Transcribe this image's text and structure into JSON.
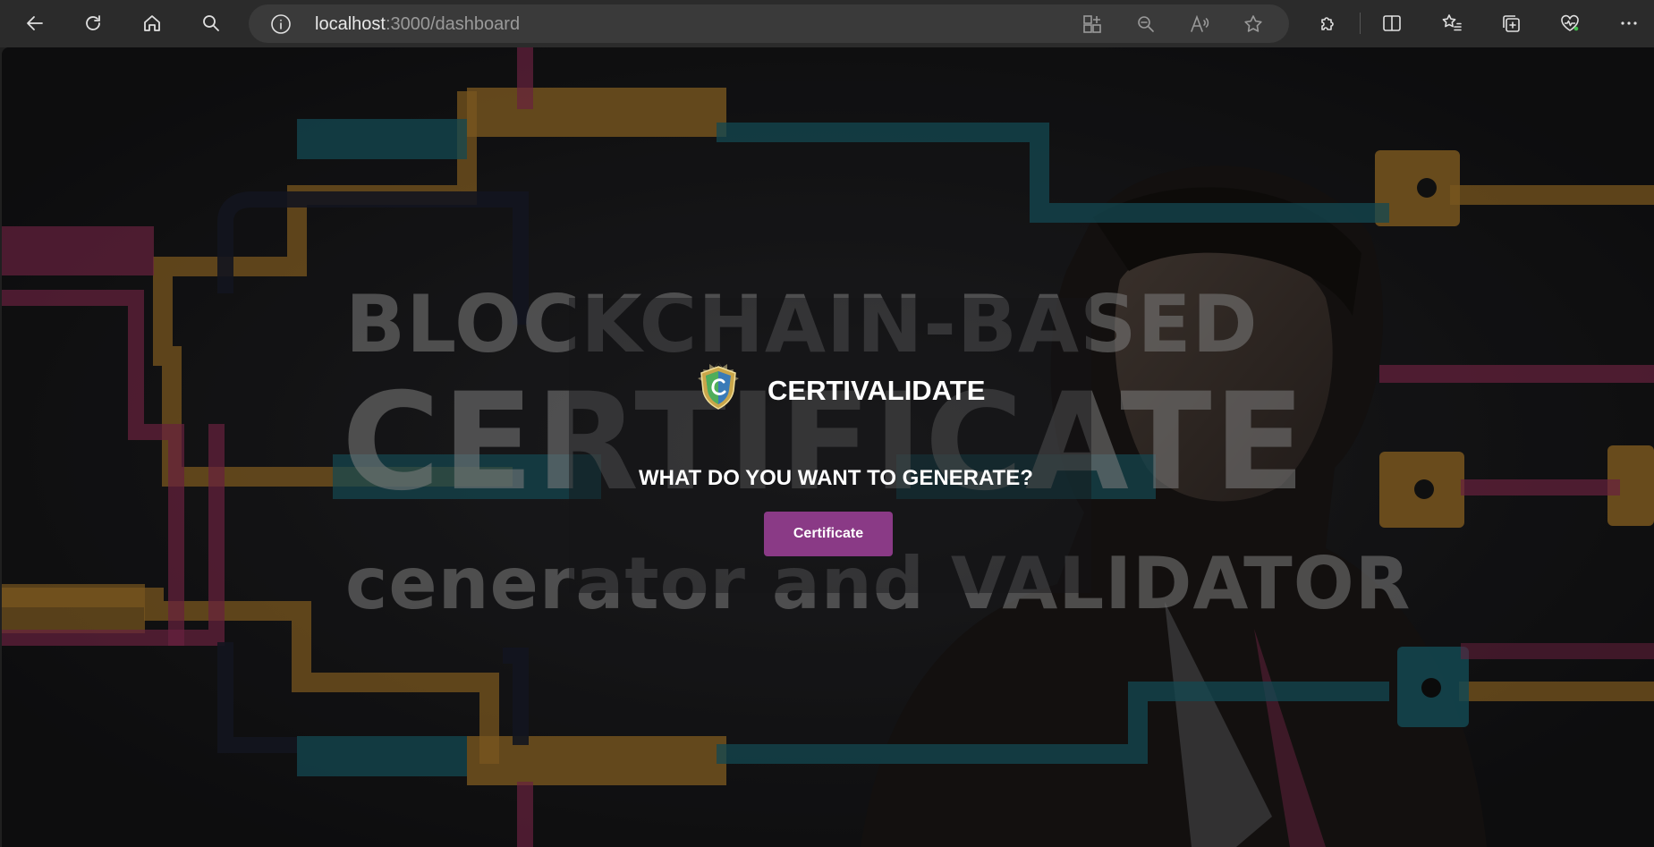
{
  "browser": {
    "url_host": "localhost",
    "url_path": ":3000/dashboard",
    "icons": {
      "back": "back-arrow-icon",
      "refresh": "refresh-icon",
      "home": "home-icon",
      "search": "search-icon",
      "site_info": "info-icon",
      "app_available": "app-grid-icon",
      "zoom": "zoom-out-icon",
      "read_aloud": "read-aloud-icon",
      "favorite": "star-icon",
      "extensions": "puzzle-icon",
      "split_screen": "split-screen-icon",
      "favorites": "favorites-list-icon",
      "collections": "collections-icon",
      "browser_essentials": "heart-pulse-icon",
      "more": "more-icon"
    }
  },
  "poster": {
    "line1": "BLOCKCHAIN-BASED",
    "line2": "CERTIFICATE",
    "line3": "cenerator and VALIDATOR"
  },
  "app": {
    "brand_name": "CERTIVALIDATE",
    "question": "WHAT DO YOU WANT TO GENERATE?",
    "certificate_button": "Certificate"
  },
  "colors": {
    "accent": "#8a3a86",
    "chrome_bg": "#2b2b2b",
    "address_bg": "#3a3a3a",
    "pipe_orange": "#b9842f",
    "pipe_teal": "#1f6f7d",
    "pipe_magenta": "#a0335f"
  }
}
